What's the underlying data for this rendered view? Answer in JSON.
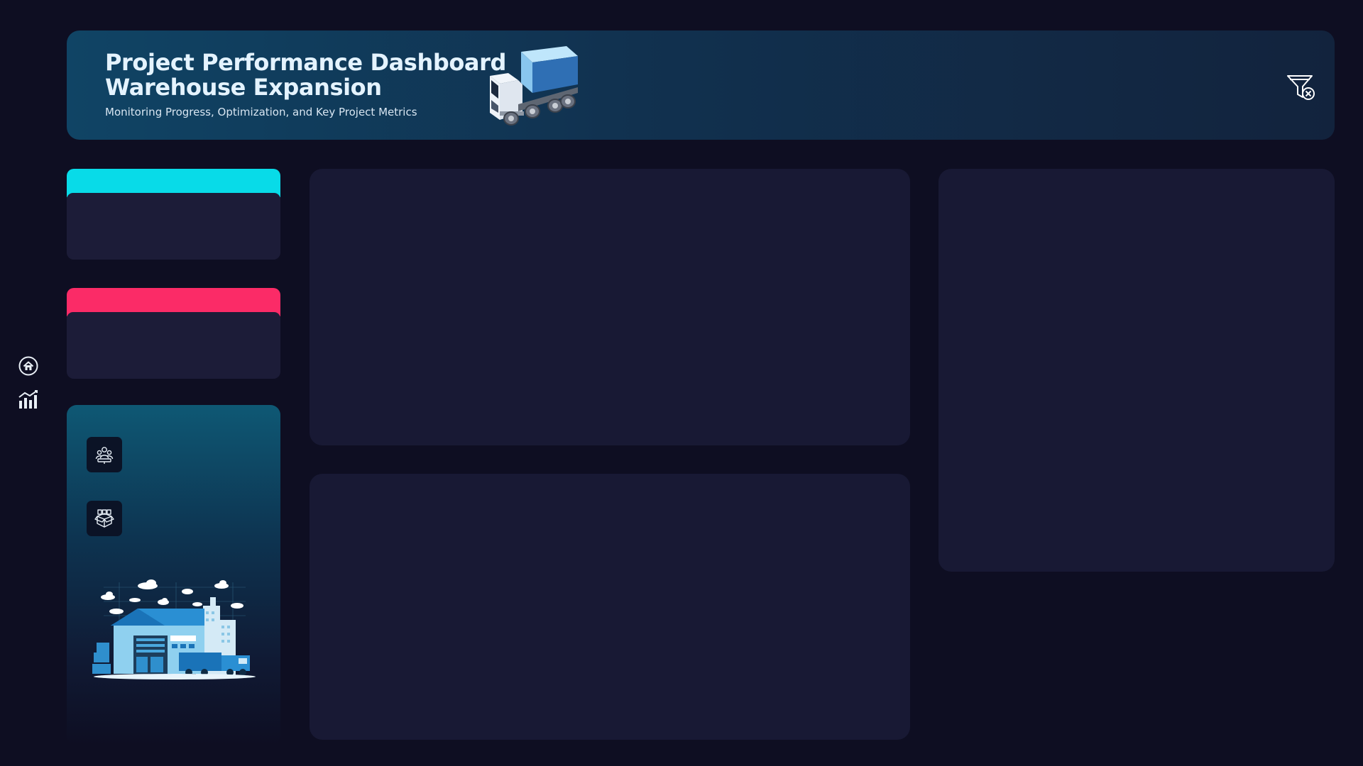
{
  "header": {
    "title_line1": "Project Performance Dashboard",
    "title_line2": "Warehouse Expansion",
    "subtitle": "Monitoring Progress, Optimization, and Key Project Metrics",
    "illustration_icon": "truck-icon",
    "filter_icon": "clear-filter-icon"
  },
  "nav": {
    "items": [
      {
        "icon": "home-icon"
      },
      {
        "icon": "bar-chart-icon"
      }
    ]
  },
  "kpi_cards": [
    {
      "accent": "#08dbe8"
    },
    {
      "accent": "#fb2b67"
    }
  ],
  "info_panel": {
    "icons": [
      "team-icon",
      "package-icon"
    ],
    "illustration_icon": "warehouse-icon"
  },
  "colors": {
    "background": "#0e0e22",
    "panel": "#181934",
    "kpi_body": "#1c1c38",
    "header_start": "#104465",
    "header_end": "#12233d"
  }
}
